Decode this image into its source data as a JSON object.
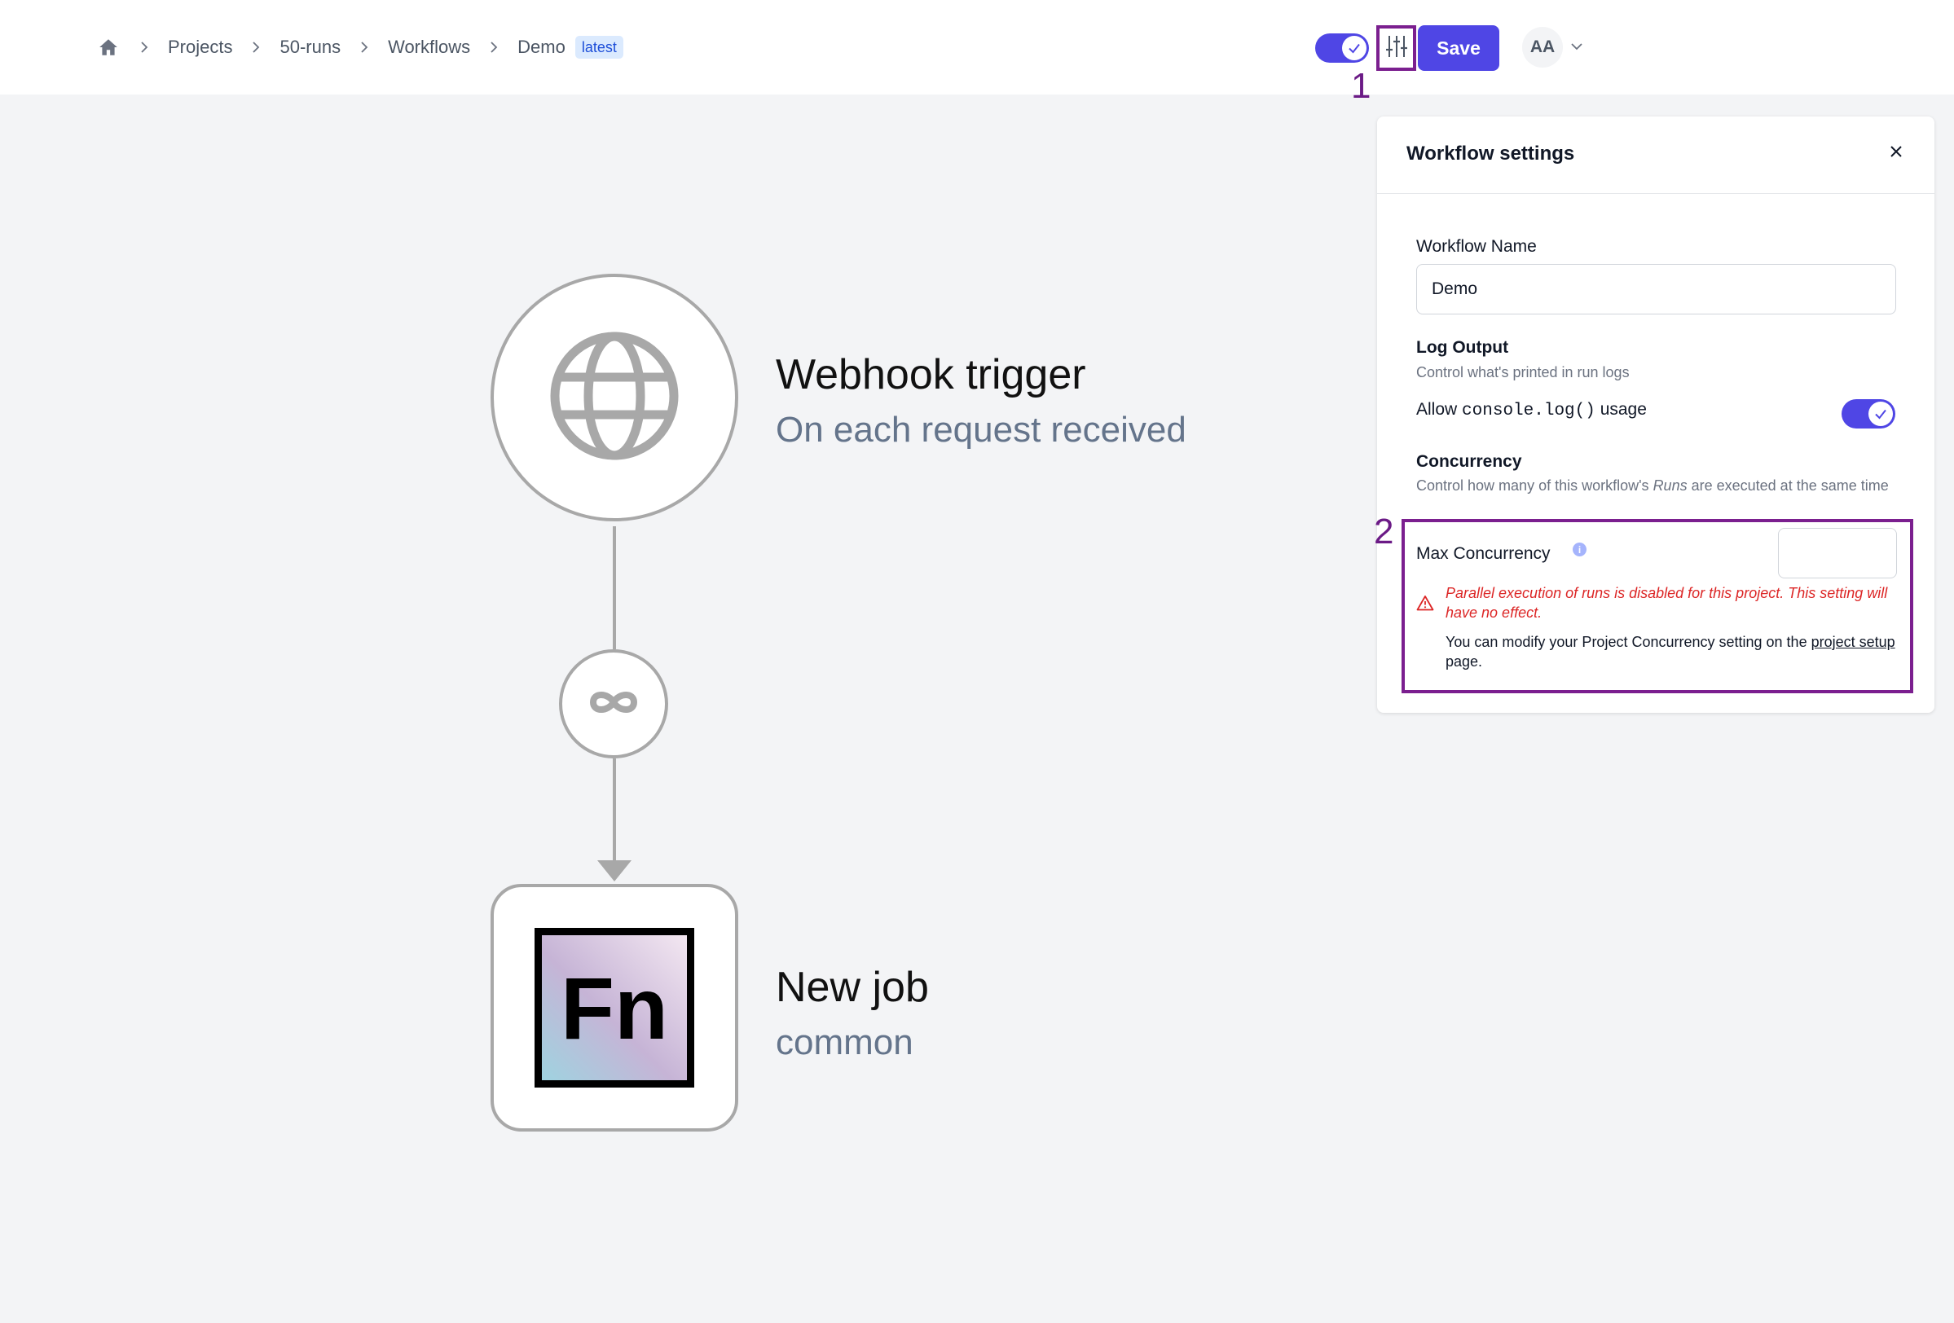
{
  "breadcrumb": {
    "items": [
      "Projects",
      "50-runs",
      "Workflows",
      "Demo"
    ],
    "badge": "latest"
  },
  "header": {
    "enabled_toggle": true,
    "save_label": "Save",
    "avatar_initials": "AA"
  },
  "markers": [
    "1",
    "2"
  ],
  "canvas": {
    "trigger": {
      "title": "Webhook trigger",
      "subtitle": "On each request received",
      "icon": "globe-icon"
    },
    "edge": {
      "icon": "infinity-icon"
    },
    "job": {
      "title": "New job",
      "subtitle": "common",
      "logo_text": "Fn"
    }
  },
  "settings": {
    "title": "Workflow settings",
    "name_label": "Workflow Name",
    "name_value": "Demo",
    "log_output_title": "Log Output",
    "log_output_help": "Control what's printed in run logs",
    "console_allow": "Allow",
    "console_code": "console.log()",
    "console_usage": "usage",
    "console_enabled": true,
    "concurrency_title": "Concurrency",
    "concurrency_help_1": "Control how many of this workflow's",
    "concurrency_help_runs": "Runs",
    "concurrency_help_2": "are executed at the same time",
    "max_concurrency_label": "Max Concurrency",
    "max_concurrency_value": "",
    "info_symbol": "i",
    "warning": "Parallel execution of runs is disabled for this project. This setting will have no effect.",
    "note_prefix": "You can modify your Project Concurrency setting on the",
    "note_link": "project setup",
    "note_suffix": "page."
  },
  "colors": {
    "accent": "#4f46e5",
    "highlight": "#7b1f8f",
    "warning": "#dc2626",
    "node_border": "#a8a8a8"
  }
}
